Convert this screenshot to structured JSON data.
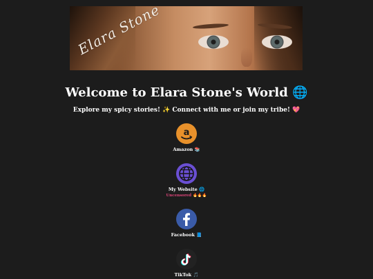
{
  "banner": {
    "signature": "Elara Stone"
  },
  "header": {
    "title": "Welcome to Elara Stone's World 🌐",
    "subtitle": "Explore my spicy stories! ✨ Connect with me or join my tribe! 💖"
  },
  "links": [
    {
      "label": "Amazon 📚",
      "icon": "amazon-icon",
      "color": "#e8912b"
    },
    {
      "label": "My Website 🌐",
      "sublabel": "Uncensored 🔥🔥🔥",
      "icon": "globe-icon",
      "color": "#6a4fd3"
    },
    {
      "label": "Facebook 📘",
      "icon": "facebook-icon",
      "color": "#3a5ba8"
    },
    {
      "label": "TikTok 🎵",
      "icon": "tiktok-icon",
      "color": "#222222"
    }
  ]
}
